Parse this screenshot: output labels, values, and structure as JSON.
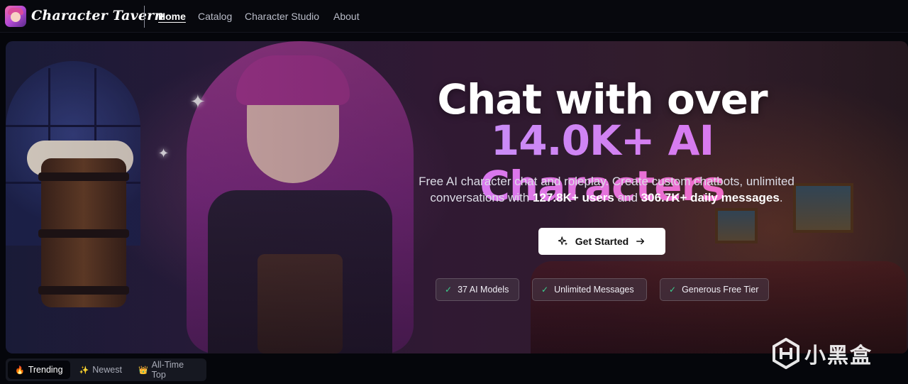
{
  "nav": {
    "brand": "Character Tavern",
    "links": [
      {
        "label": "Home",
        "active": true
      },
      {
        "label": "Catalog",
        "active": false
      },
      {
        "label": "Character Studio",
        "active": false
      },
      {
        "label": "About",
        "active": false
      }
    ]
  },
  "hero": {
    "title_line1": "Chat with over",
    "title_line2": "14.0K+ AI Characters",
    "subtitle_part1": "Free AI character chat and roleplay. Create custom chatbots, unlimited conversations with ",
    "users_count": "127.8K+ users",
    "subtitle_and": " and ",
    "daily_messages": "306.7K+ daily messages",
    "subtitle_end": ".",
    "cta_label": "Get Started",
    "features": [
      {
        "label": "37 AI Models"
      },
      {
        "label": "Unlimited Messages"
      },
      {
        "label": "Generous Free Tier"
      }
    ]
  },
  "tabs": [
    {
      "label": "Trending",
      "icon": "fire-icon",
      "emoji": "🔥",
      "active": true
    },
    {
      "label": "Newest",
      "icon": "sparkles-icon",
      "emoji": "✨",
      "active": false
    },
    {
      "label": "All-Time Top",
      "icon": "crown-icon",
      "emoji": "👑",
      "active": false
    }
  ],
  "watermark": {
    "text": "小黑盒"
  },
  "colors": {
    "accent_gradient_start": "#c98cf7",
    "accent_gradient_end": "#f06cc8",
    "check": "#3ccf8e",
    "background": "#05060b"
  }
}
